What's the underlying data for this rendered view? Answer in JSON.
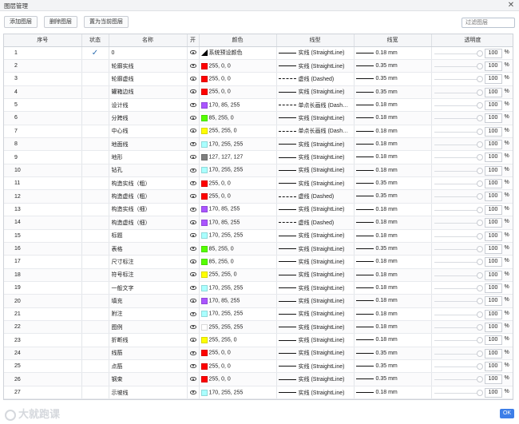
{
  "window": {
    "title": "图层管理",
    "close_glyph": "✕"
  },
  "toolbar": {
    "add_label": "添加图层",
    "delete_label": "删除图层",
    "set_current_label": "置为当前图层",
    "search_placeholder": "过滤图层"
  },
  "table": {
    "headers": [
      "序号",
      "状态",
      "名称",
      "开",
      "颜色",
      "线型",
      "线宽",
      "透明度"
    ],
    "rows": [
      {
        "idx": "1",
        "current": true,
        "name": "0",
        "color": "default",
        "color_label": "系统预设颜色",
        "linetype": "solid",
        "linetype_label": "实线 (StraightLine)",
        "width": "0.18 mm",
        "opacity": "100"
      },
      {
        "idx": "2",
        "current": false,
        "name": "轮廓实线",
        "color": "#ff0000",
        "color_label": "255, 0, 0",
        "linetype": "solid",
        "linetype_label": "实线 (StraightLine)",
        "width": "0.35 mm",
        "opacity": "100"
      },
      {
        "idx": "3",
        "current": false,
        "name": "轮廓虚线",
        "color": "#ff0000",
        "color_label": "255, 0, 0",
        "linetype": "dashed",
        "linetype_label": "虚线 (Dashed)",
        "width": "0.35 mm",
        "opacity": "100"
      },
      {
        "idx": "4",
        "current": false,
        "name": "罐箱边线",
        "color": "#ff0000",
        "color_label": "255, 0, 0",
        "linetype": "solid",
        "linetype_label": "实线 (StraightLine)",
        "width": "0.35 mm",
        "opacity": "100"
      },
      {
        "idx": "5",
        "current": false,
        "name": "设计线",
        "color": "#aa55ff",
        "color_label": "170, 85, 255",
        "linetype": "dashdot",
        "linetype_label": "单点长画线 (Dash…",
        "width": "0.18 mm",
        "opacity": "100"
      },
      {
        "idx": "6",
        "current": false,
        "name": "分跨线",
        "color": "#55ff00",
        "color_label": "85, 255, 0",
        "linetype": "solid",
        "linetype_label": "实线 (StraightLine)",
        "width": "0.18 mm",
        "opacity": "100"
      },
      {
        "idx": "7",
        "current": false,
        "name": "中心线",
        "color": "#ffff00",
        "color_label": "255, 255, 0",
        "linetype": "dashdot",
        "linetype_label": "单点长画线 (Dash…",
        "width": "0.18 mm",
        "opacity": "100"
      },
      {
        "idx": "8",
        "current": false,
        "name": "地面线",
        "color": "#aaffff",
        "color_label": "170, 255, 255",
        "linetype": "solid",
        "linetype_label": "实线 (StraightLine)",
        "width": "0.18 mm",
        "opacity": "100"
      },
      {
        "idx": "9",
        "current": false,
        "name": "地形",
        "color": "#7f7f7f",
        "color_label": "127, 127, 127",
        "linetype": "solid",
        "linetype_label": "实线 (StraightLine)",
        "width": "0.18 mm",
        "opacity": "100"
      },
      {
        "idx": "10",
        "current": false,
        "name": "钻孔",
        "color": "#aaffff",
        "color_label": "170, 255, 255",
        "linetype": "solid",
        "linetype_label": "实线 (StraightLine)",
        "width": "0.18 mm",
        "opacity": "100"
      },
      {
        "idx": "11",
        "current": false,
        "name": "构造实线（粗）",
        "color": "#ff0000",
        "color_label": "255, 0, 0",
        "linetype": "solid",
        "linetype_label": "实线 (StraightLine)",
        "width": "0.35 mm",
        "opacity": "100"
      },
      {
        "idx": "12",
        "current": false,
        "name": "构造虚线（粗）",
        "color": "#ff0000",
        "color_label": "255, 0, 0",
        "linetype": "dashed",
        "linetype_label": "虚线 (Dashed)",
        "width": "0.35 mm",
        "opacity": "100"
      },
      {
        "idx": "13",
        "current": false,
        "name": "构造实线（细）",
        "color": "#aa55ff",
        "color_label": "170, 85, 255",
        "linetype": "solid",
        "linetype_label": "实线 (StraightLine)",
        "width": "0.18 mm",
        "opacity": "100"
      },
      {
        "idx": "14",
        "current": false,
        "name": "构造虚线（细）",
        "color": "#aa55ff",
        "color_label": "170, 85, 255",
        "linetype": "dashed",
        "linetype_label": "虚线 (Dashed)",
        "width": "0.18 mm",
        "opacity": "100"
      },
      {
        "idx": "15",
        "current": false,
        "name": "标题",
        "color": "#aaffff",
        "color_label": "170, 255, 255",
        "linetype": "solid",
        "linetype_label": "实线 (StraightLine)",
        "width": "0.18 mm",
        "opacity": "100"
      },
      {
        "idx": "16",
        "current": false,
        "name": "表格",
        "color": "#55ff00",
        "color_label": "85, 255, 0",
        "linetype": "solid",
        "linetype_label": "实线 (StraightLine)",
        "width": "0.35 mm",
        "opacity": "100"
      },
      {
        "idx": "17",
        "current": false,
        "name": "尺寸标注",
        "color": "#55ff00",
        "color_label": "85, 255, 0",
        "linetype": "solid",
        "linetype_label": "实线 (StraightLine)",
        "width": "0.18 mm",
        "opacity": "100"
      },
      {
        "idx": "18",
        "current": false,
        "name": "符号标注",
        "color": "#ffff00",
        "color_label": "255, 255, 0",
        "linetype": "solid",
        "linetype_label": "实线 (StraightLine)",
        "width": "0.18 mm",
        "opacity": "100"
      },
      {
        "idx": "19",
        "current": false,
        "name": "一般文字",
        "color": "#aaffff",
        "color_label": "170, 255, 255",
        "linetype": "solid",
        "linetype_label": "实线 (StraightLine)",
        "width": "0.18 mm",
        "opacity": "100"
      },
      {
        "idx": "20",
        "current": false,
        "name": "填充",
        "color": "#aa55ff",
        "color_label": "170, 85, 255",
        "linetype": "solid",
        "linetype_label": "实线 (StraightLine)",
        "width": "0.18 mm",
        "opacity": "100"
      },
      {
        "idx": "21",
        "current": false,
        "name": "附注",
        "color": "#aaffff",
        "color_label": "170, 255, 255",
        "linetype": "solid",
        "linetype_label": "实线 (StraightLine)",
        "width": "0.18 mm",
        "opacity": "100"
      },
      {
        "idx": "22",
        "current": false,
        "name": "图例",
        "color": "#ffffff",
        "color_label": "255, 255, 255",
        "linetype": "solid",
        "linetype_label": "实线 (StraightLine)",
        "width": "0.18 mm",
        "opacity": "100"
      },
      {
        "idx": "23",
        "current": false,
        "name": "折断线",
        "color": "#ffff00",
        "color_label": "255, 255, 0",
        "linetype": "solid",
        "linetype_label": "实线 (StraightLine)",
        "width": "0.18 mm",
        "opacity": "100"
      },
      {
        "idx": "24",
        "current": false,
        "name": "线筋",
        "color": "#ff0000",
        "color_label": "255, 0, 0",
        "linetype": "solid",
        "linetype_label": "实线 (StraightLine)",
        "width": "0.35 mm",
        "opacity": "100"
      },
      {
        "idx": "25",
        "current": false,
        "name": "点筋",
        "color": "#ff0000",
        "color_label": "255, 0, 0",
        "linetype": "solid",
        "linetype_label": "实线 (StraightLine)",
        "width": "0.35 mm",
        "opacity": "100"
      },
      {
        "idx": "26",
        "current": false,
        "name": "钢束",
        "color": "#ff0000",
        "color_label": "255, 0, 0",
        "linetype": "solid",
        "linetype_label": "实线 (StraightLine)",
        "width": "0.35 mm",
        "opacity": "100"
      },
      {
        "idx": "27",
        "current": false,
        "name": "示坡线",
        "color": "#aaffff",
        "color_label": "170, 255, 255",
        "linetype": "solid",
        "linetype_label": "实线 (StraightLine)",
        "width": "0.18 mm",
        "opacity": "100"
      }
    ],
    "check_glyph": "✓",
    "percent_sign": "%"
  },
  "footer": {
    "ok_label": "OK",
    "watermark_text": "大就跑课"
  },
  "icons": {
    "visible": "eye-icon",
    "status": "check-icon"
  }
}
